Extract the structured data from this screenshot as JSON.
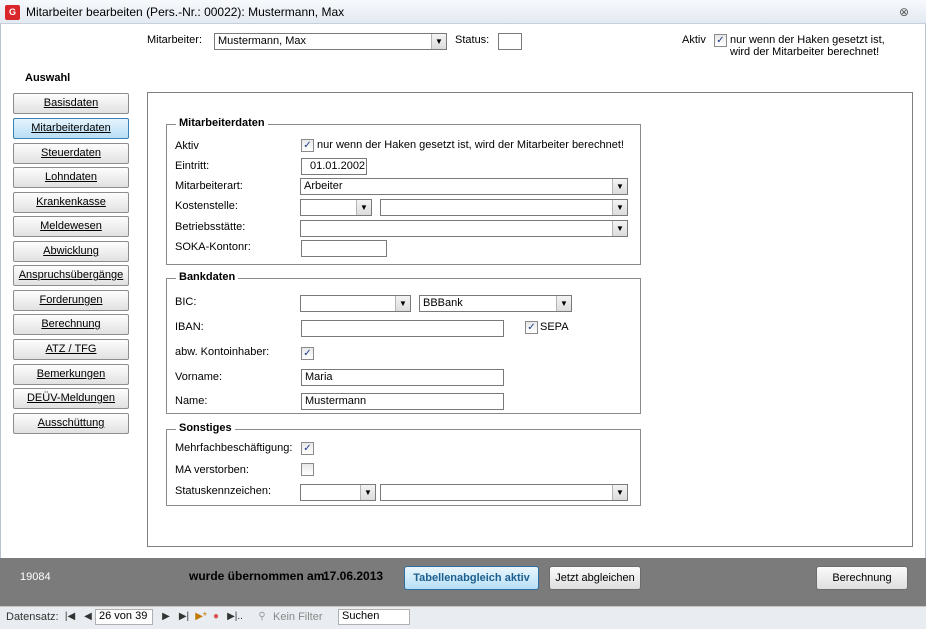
{
  "window": {
    "title": "Mitarbeiter bearbeiten (Pers.-Nr.: 00022): Mustermann, Max",
    "icon": "app-icon",
    "close_glyph": "⊗"
  },
  "header": {
    "employee_label": "Mitarbeiter:",
    "employee_value": "Mustermann, Max",
    "status_label": "Status:",
    "status_value": "",
    "active_label": "Aktiv",
    "active_checked": true,
    "active_hint_line1": "nur wenn der Haken gesetzt ist,",
    "active_hint_line2": "wird der Mitarbeiter berechnet!"
  },
  "sidebar": {
    "title": "Auswahl",
    "items": [
      {
        "label": "Basisdaten",
        "active": false
      },
      {
        "label": "Mitarbeiterdaten",
        "active": true
      },
      {
        "label": "Steuerdaten",
        "active": false
      },
      {
        "label": "Lohndaten",
        "active": false
      },
      {
        "label": "Krankenkasse",
        "active": false
      },
      {
        "label": "Meldewesen",
        "active": false
      },
      {
        "label": "Abwicklung",
        "active": false
      },
      {
        "label": "Anspruchsübergänge",
        "active": false
      },
      {
        "label": "Forderungen",
        "active": false
      },
      {
        "label": "Berechnung",
        "active": false
      },
      {
        "label": "ATZ / TFG",
        "active": false
      },
      {
        "label": "Bemerkungen",
        "active": false
      },
      {
        "label": "DEÜV-Meldungen",
        "active": false
      },
      {
        "label": "Ausschüttung",
        "active": false
      }
    ]
  },
  "mitarbeiterdaten": {
    "title": "Mitarbeiterdaten",
    "aktiv_label": "Aktiv",
    "aktiv_checked": true,
    "aktiv_hint": "nur wenn der Haken gesetzt ist, wird der Mitarbeiter berechnet!",
    "eintritt_label": "Eintritt:",
    "eintritt_value": "01.01.2002",
    "art_label": "Mitarbeiterart:",
    "art_value": "Arbeiter",
    "kostenstelle_label": "Kostenstelle:",
    "kostenstelle_value1": "",
    "kostenstelle_value2": "",
    "betriebsstaette_label": "Betriebsstätte:",
    "betriebsstaette_value": "",
    "soka_label": "SOKA-Kontonr:",
    "soka_value": ""
  },
  "bankdaten": {
    "title": "Bankdaten",
    "bic_label": "BIC:",
    "bic_value": "",
    "bank_value": "BBBank",
    "iban_label": "IBAN:",
    "iban_value": "",
    "sepa_label": "SEPA",
    "sepa_checked": true,
    "abw_label": "abw. Kontoinhaber:",
    "abw_checked": true,
    "vorname_label": "Vorname:",
    "vorname_value": "Maria",
    "name_label": "Name:",
    "name_value": "Mustermann"
  },
  "sonstiges": {
    "title": "Sonstiges",
    "mehrfach_label": "Mehrfachbeschäftigung:",
    "mehrfach_checked": true,
    "verstorben_label": "MA verstorben:",
    "verstorben_checked": false,
    "status_label": "Statuskennzeichen:",
    "status_value1": "",
    "status_value2": ""
  },
  "footer": {
    "id_value": "19084",
    "uebernommen_text": "wurde übernommen am",
    "uebernommen_date": "17.06.2013",
    "tabellenabgleich_label": "Tabellenabgleich aktiv",
    "jetzt_abgleichen_label": "Jetzt abgleichen",
    "berechnung_label": "Berechnung"
  },
  "record_nav": {
    "label": "Datensatz:",
    "position": "26 von 39",
    "filter_label": "Kein Filter",
    "search_value": "Suchen"
  },
  "colors": {
    "footer_bg": "#7b7b7b",
    "active_nav_bg": "#b8def6",
    "highlight_text": "#1d5f8f"
  }
}
